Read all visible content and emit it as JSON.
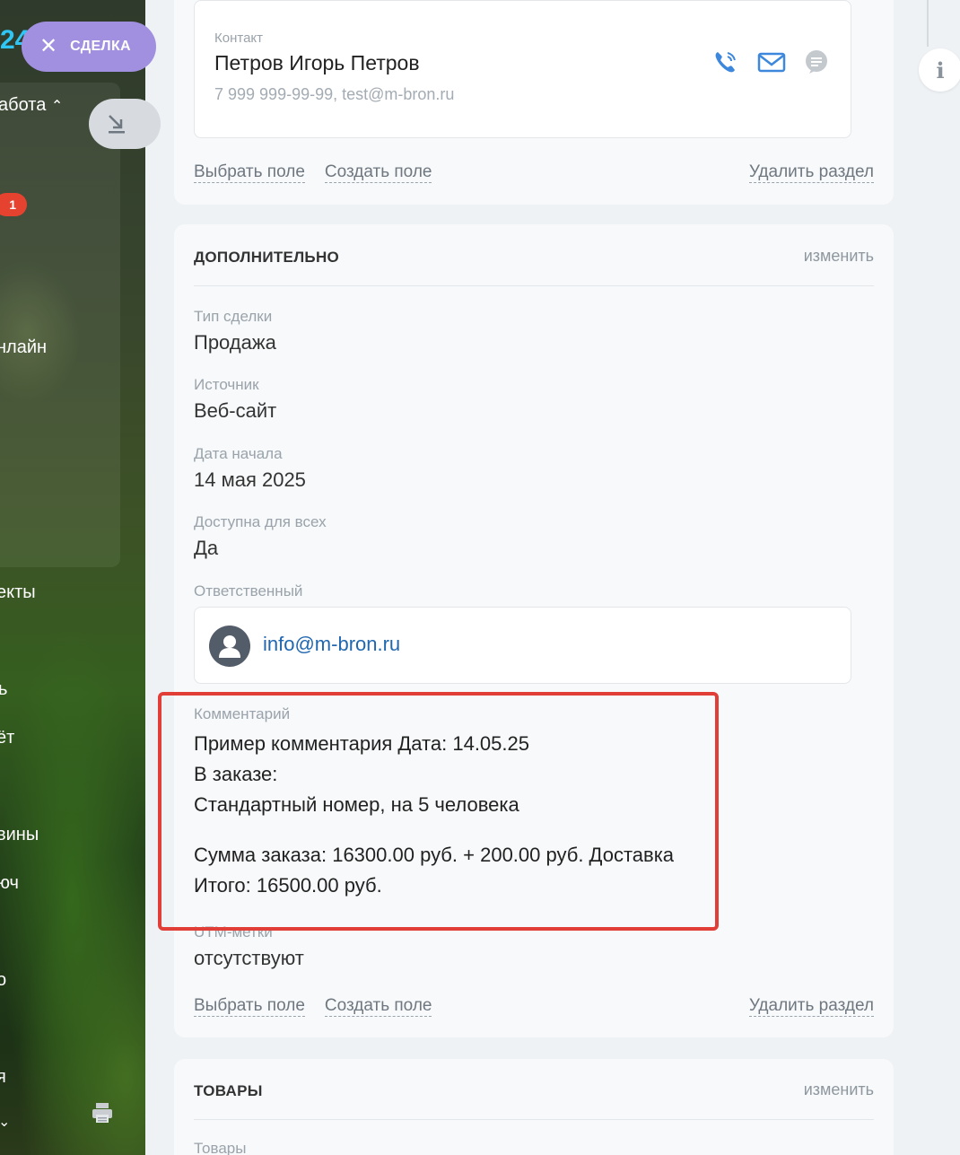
{
  "sidebar": {
    "logo_fragment": "24",
    "deal_pill_label": "СДЕЛКА",
    "badge_count": "1",
    "items": [
      {
        "text": "абота",
        "top": 0
      },
      {
        "text": "нлайн"
      },
      {
        "text": "екты"
      },
      {
        "text": "ь"
      },
      {
        "text": "ёт"
      },
      {
        "text": "вины"
      },
      {
        "text": "юч"
      },
      {
        "text": "о"
      },
      {
        "text": "я"
      }
    ]
  },
  "contact": {
    "label": "Контакт",
    "name": "Петров Игорь Петров",
    "details": "7 999 999-99-99, test@m-bron.ru",
    "icons": [
      "phone-icon",
      "mail-icon",
      "chat-icon"
    ]
  },
  "footer_actions": {
    "select_field": "Выбрать поле",
    "create_field": "Создать поле",
    "delete_section": "Удалить раздел"
  },
  "additional": {
    "title": "ДОПОЛНИТЕЛЬНО",
    "edit": "изменить",
    "fields": [
      {
        "label": "Тип сделки",
        "value": "Продажа"
      },
      {
        "label": "Источник",
        "value": "Веб-сайт"
      },
      {
        "label": "Дата начала",
        "value": "14 мая 2025"
      },
      {
        "label": "Доступна для всех",
        "value": "Да"
      }
    ],
    "responsible_label": "Ответственный",
    "responsible_value": "info@m-bron.ru",
    "comment_label": "Комментарий",
    "comment_lines": [
      "Пример комментария Дата: 14.05.25",
      "В заказе:",
      "Стандартный номер, на 5 человека",
      "Сумма заказа: 16300.00 руб. + 200.00 руб. Доставка",
      "Итого: 16500.00 руб."
    ],
    "utm_label": "UTM-метки",
    "utm_value": "отсутствуют"
  },
  "products": {
    "title": "ТОВАРЫ",
    "edit": "изменить",
    "field_label": "Товары"
  },
  "colors": {
    "accent_link": "#2067b0",
    "deal_pill": "#a18fe0",
    "highlight": "#e03e36",
    "icon_blue": "#3d88dc"
  }
}
